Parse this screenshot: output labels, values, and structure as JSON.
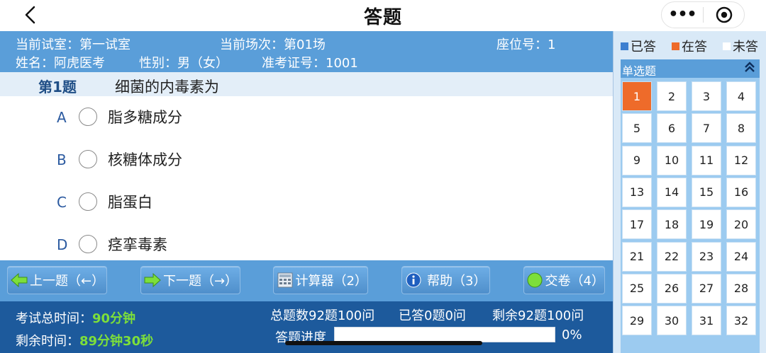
{
  "nav": {
    "title": "答题",
    "more_label": "•••",
    "icons": {
      "back": "chevron-left-icon",
      "close": "target-circle-icon"
    }
  },
  "info": {
    "room": "当前试室：第一试室",
    "session": "当前场次：第01场",
    "seat": "座位号：1",
    "name": "姓名：阿虎医考",
    "gender": "性别：男（女）",
    "ticket": "准考证号：1001"
  },
  "question": {
    "number": "第1题",
    "text": "细菌的内毒素为",
    "options": [
      {
        "letter": "A",
        "text": "脂多糖成分"
      },
      {
        "letter": "B",
        "text": "核糖体成分"
      },
      {
        "letter": "C",
        "text": "脂蛋白"
      },
      {
        "letter": "D",
        "text": "痉挛毒素"
      }
    ]
  },
  "toolbar": {
    "prev": "上一题（←）",
    "next": "下一题（→）",
    "calc": "计算器（2）",
    "help": "帮助（3）",
    "submit": "交卷（4）",
    "colors": {
      "arrow": "#7ddf3a",
      "submit": "#7ddf3a"
    }
  },
  "footer": {
    "total_time_label": "考试总时间：",
    "total_time_value": "90分钟",
    "remaining_label": "剩余时间：",
    "remaining_value": "89分钟30秒",
    "total_questions": "总题数92题100问",
    "answered": "已答0题0问",
    "remaining_questions": "剩余92题100问",
    "progress_label": "答题进度",
    "progress_text": "0%",
    "progress": 0
  },
  "panel": {
    "legend": [
      {
        "label": "已答",
        "color": "#3d7fd0"
      },
      {
        "label": "在答",
        "color": "#ee6b2a"
      },
      {
        "label": "未答",
        "color": "#ffffff"
      }
    ],
    "section": "单选题",
    "current": 1,
    "cells": [
      "1",
      "2",
      "3",
      "4",
      "5",
      "6",
      "7",
      "8",
      "9",
      "10",
      "11",
      "12",
      "13",
      "14",
      "15",
      "16",
      "17",
      "18",
      "19",
      "20",
      "21",
      "22",
      "23",
      "24",
      "25",
      "26",
      "27",
      "28",
      "29",
      "30",
      "31",
      "32"
    ]
  }
}
